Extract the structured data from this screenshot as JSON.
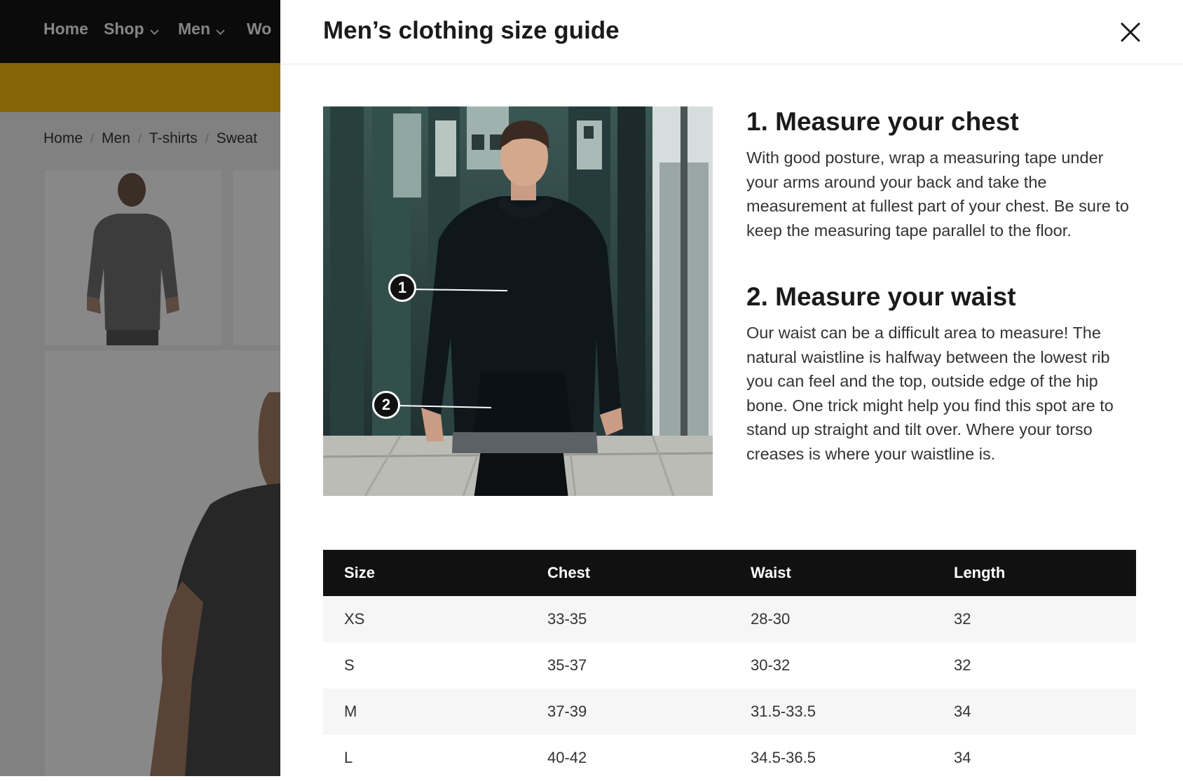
{
  "background_page": {
    "nav": {
      "items": [
        "Home",
        "Shop",
        "Men",
        "Wo"
      ]
    },
    "breadcrumb": [
      "Home",
      "Men",
      "T-shirts",
      "Sweat"
    ],
    "colors": {
      "nav_bg": "#141414",
      "promo_bar": "#f6b40f"
    }
  },
  "drawer": {
    "title": "Men’s clothing size guide",
    "close_icon": "close-icon",
    "photo": {
      "markers": [
        "1",
        "2"
      ]
    },
    "steps": [
      {
        "title": "1. Measure your chest",
        "body": "With good posture, wrap a measuring tape under your arms around your back and take the measurement at fullest part of your chest. Be sure to keep the measuring tape parallel to the floor."
      },
      {
        "title": "2. Measure your waist",
        "body": "Our waist can be a difficult area to measure! The natural waistline is halfway between the lowest rib you can feel and the top, outside edge of the hip bone. One trick might help you find this spot are to stand up straight and tilt over. Where your torso creases is where your waistline is."
      }
    ],
    "table": {
      "headers": [
        "Size",
        "Chest",
        "Waist",
        "Length"
      ],
      "rows": [
        [
          "XS",
          "33-35",
          "28-30",
          "32"
        ],
        [
          "S",
          "35-37",
          "30-32",
          "32"
        ],
        [
          "M",
          "37-39",
          "31.5-33.5",
          "34"
        ],
        [
          "L",
          "40-42",
          "34.5-36.5",
          "34"
        ]
      ]
    }
  }
}
